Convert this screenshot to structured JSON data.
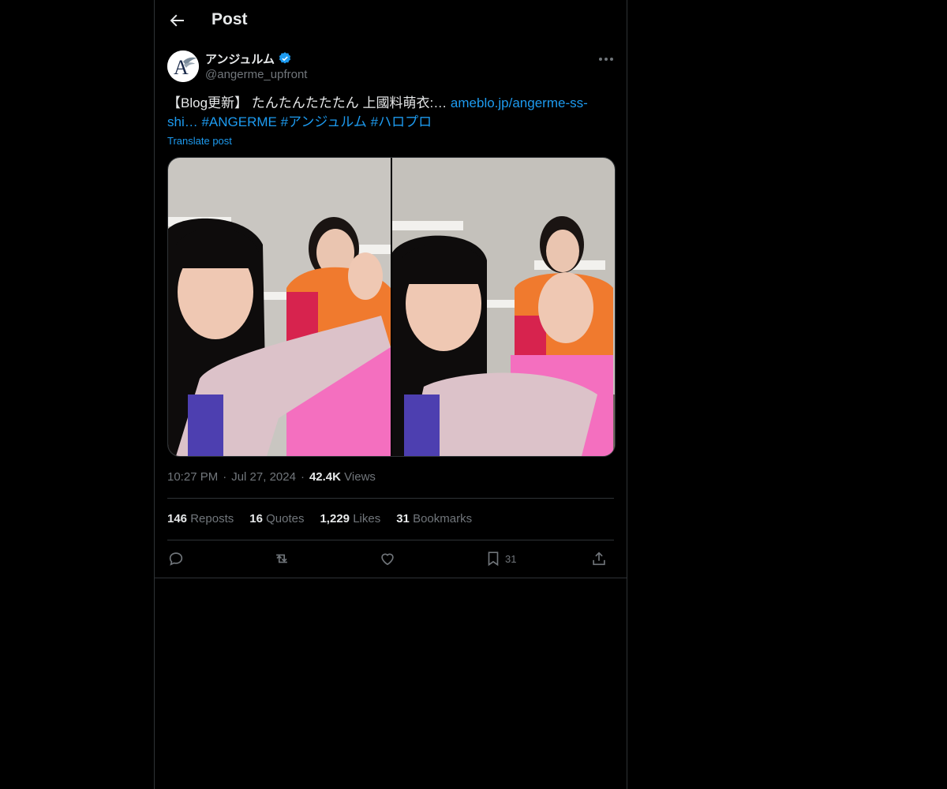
{
  "header": {
    "title": "Post"
  },
  "author": {
    "name": "アンジュルム",
    "handle": "@angerme_upfront",
    "verified": true,
    "avatar_letters": "A"
  },
  "post": {
    "text_prefix": "【Blog更新】 たんたんたたたん 上國料萌衣:… ",
    "link": "ameblo.jp/angerme-ss-shi…",
    "hashtags": [
      "#ANGERME",
      "#アンジュルム",
      "#ハロプロ"
    ],
    "translate_label": "Translate post"
  },
  "meta": {
    "time": "10:27 PM",
    "date": "Jul 27, 2024",
    "views_count": "42.4K",
    "views_label": "Views"
  },
  "stats": [
    {
      "count": "146",
      "label": "Reposts"
    },
    {
      "count": "16",
      "label": "Quotes"
    },
    {
      "count": "1,229",
      "label": "Likes"
    },
    {
      "count": "31",
      "label": "Bookmarks"
    }
  ],
  "actions": {
    "bookmark_count": "31"
  },
  "colors": {
    "accent": "#1d9bf0",
    "background": "#000000",
    "border": "#2f3336",
    "muted": "#71767b",
    "text": "#e7e9ea"
  },
  "icons": [
    "back-arrow-icon",
    "verified-badge-icon",
    "more-icon",
    "reply-icon",
    "repost-icon",
    "like-icon",
    "bookmark-icon",
    "share-icon"
  ]
}
